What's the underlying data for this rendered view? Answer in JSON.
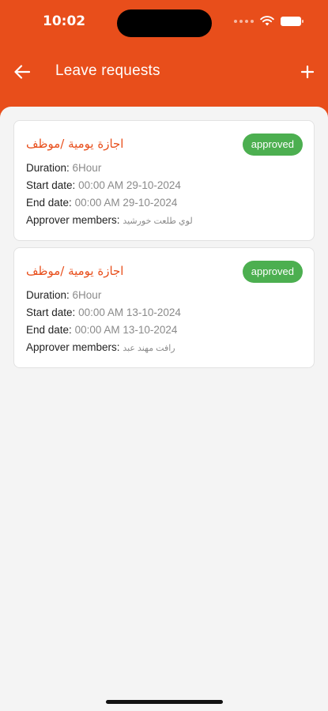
{
  "status_bar": {
    "time": "10:02"
  },
  "header": {
    "title": "Leave requests",
    "back_icon": "arrow-left-icon",
    "add_icon": "plus-icon"
  },
  "colors": {
    "primary": "#e84e1b",
    "approved": "#4caf50"
  },
  "requests": [
    {
      "title": "اجازة يومية /موظف",
      "status": "approved",
      "duration_label": "Duration:",
      "duration_value": "6Hour",
      "start_label": "Start date:",
      "start_value": "00:00 AM 29-10-2024",
      "end_label": "End date:",
      "end_value": "00:00 AM 29-10-2024",
      "approver_label": "Approver members:",
      "approver_value": "لوي طلعت خورشيد"
    },
    {
      "title": "اجازة يومية /موظف",
      "status": "approved",
      "duration_label": "Duration:",
      "duration_value": "6Hour",
      "start_label": "Start date:",
      "start_value": "00:00 AM 13-10-2024",
      "end_label": "End date:",
      "end_value": "00:00 AM 13-10-2024",
      "approver_label": "Approver members:",
      "approver_value": "رافت مهند عبد"
    }
  ]
}
